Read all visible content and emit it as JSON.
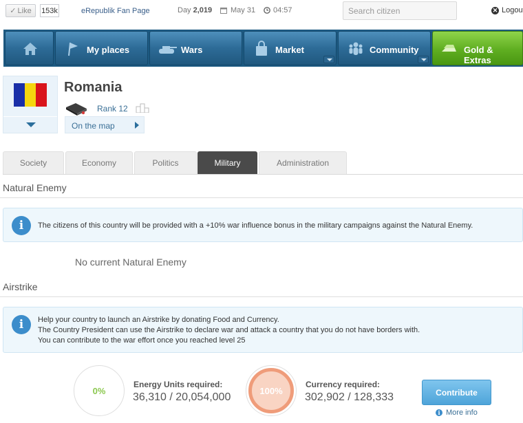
{
  "topbar": {
    "like_label": "Like",
    "like_count": "153k",
    "fan_page": "eRepublik Fan Page",
    "day_label": "Day",
    "day_number": "2,019",
    "date": "May 31",
    "time": "04:57",
    "search_placeholder": "Search citizen",
    "logout": "Logout"
  },
  "nav": {
    "items": [
      {
        "label": "",
        "icon": "home-icon"
      },
      {
        "label": "My places",
        "icon": "flag-icon"
      },
      {
        "label": "Wars",
        "icon": "tank-icon"
      },
      {
        "label": "Market",
        "icon": "bag-icon"
      },
      {
        "label": "Community",
        "icon": "people-icon"
      },
      {
        "label": "Gold & Extras",
        "icon": "gold-icon"
      }
    ]
  },
  "country": {
    "name": "Romania",
    "rank": "Rank 12",
    "on_the_map": "On the map",
    "flag_colors": [
      "#1a2fa8",
      "#f5d60e",
      "#d9141b"
    ]
  },
  "tabs": [
    {
      "label": "Society",
      "active": false
    },
    {
      "label": "Economy",
      "active": false
    },
    {
      "label": "Politics",
      "active": false
    },
    {
      "label": "Military",
      "active": true
    },
    {
      "label": "Administration",
      "active": false
    }
  ],
  "natural_enemy": {
    "title": "Natural Enemy",
    "info": "The citizens of this country will be provided with a +10% war influence bonus in the military campaigns against the Natural Enemy.",
    "empty": "No current Natural Enemy"
  },
  "airstrike": {
    "title": "Airstrike",
    "info_lines": [
      "Help your country to launch an Airstrike by donating Food and Currency.",
      "The Country President can use the Airstrike to declare war and attack a country that you do not have borders with.",
      "You can contribute to the war effort once you reached level 25"
    ],
    "energy": {
      "percent": "0%",
      "label": "Energy Units required:",
      "value": "36,310 / 20,054,000"
    },
    "currency": {
      "percent": "100%",
      "label": "Currency required:",
      "value": "302,902 / 128,333"
    },
    "contribute": "Contribute",
    "more_info": "More info"
  },
  "colors": {
    "nav_blue": "#2d6b97",
    "nav_gold": "#5fae21",
    "info_blue": "#3c8dcb",
    "energy_green": "#8cc850",
    "currency_orange": "#ef9c7a"
  }
}
